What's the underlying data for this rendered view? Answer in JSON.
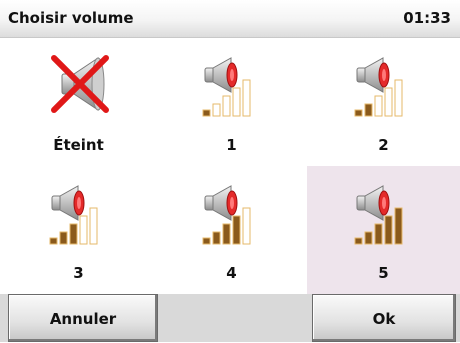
{
  "header": {
    "title": "Choisir volume",
    "time": "01:33"
  },
  "options": [
    {
      "label": "Éteint",
      "level": 0,
      "muted": true,
      "selected": false
    },
    {
      "label": "1",
      "level": 1,
      "muted": false,
      "selected": false
    },
    {
      "label": "2",
      "level": 2,
      "muted": false,
      "selected": false
    },
    {
      "label": "3",
      "level": 3,
      "muted": false,
      "selected": false
    },
    {
      "label": "4",
      "level": 4,
      "muted": false,
      "selected": false
    },
    {
      "label": "5",
      "level": 5,
      "muted": false,
      "selected": true
    }
  ],
  "footer": {
    "cancel_label": "Annuler",
    "ok_label": "Ok"
  },
  "colors": {
    "bar_filled": "#8a5a1c",
    "bar_outline": "#e6b86a",
    "cross": "#e01818",
    "selected_bg": "#eee4ec"
  }
}
